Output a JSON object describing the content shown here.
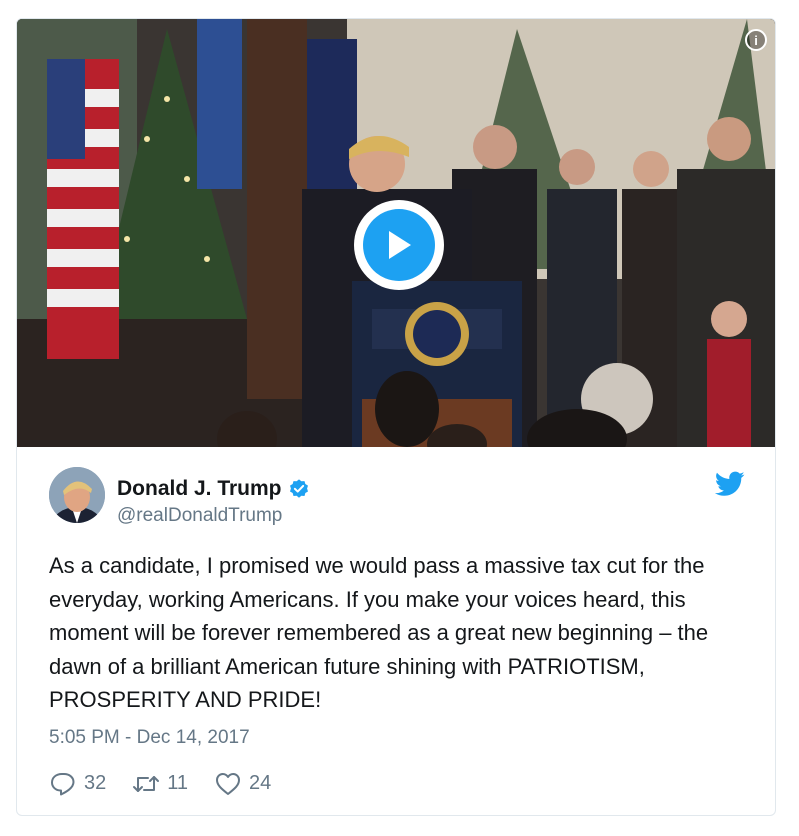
{
  "media": {
    "info_icon": "info-icon",
    "play_icon": "play-icon",
    "accent": "#1da1f2"
  },
  "tweet": {
    "author_name": "Donald J. Trump",
    "handle": "@realDonaldTrump",
    "verified_icon": "verified-badge-icon",
    "logo_icon": "twitter-bird-icon",
    "text": "As a candidate, I promised we would pass a massive tax cut for the everyday, working Americans. If you make your voices heard, this moment will be forever remembered as a great new beginning – the dawn of a brilliant American future shining with PATRIOTISM, PROSPERITY AND PRIDE!",
    "timestamp": "5:05 PM - Dec 14, 2017"
  },
  "actions": {
    "reply_count": "32",
    "retweet_count": "11",
    "like_count": "24"
  },
  "colors": {
    "text": "#14171a",
    "secondary": "#657786",
    "brand": "#1da1f2"
  }
}
